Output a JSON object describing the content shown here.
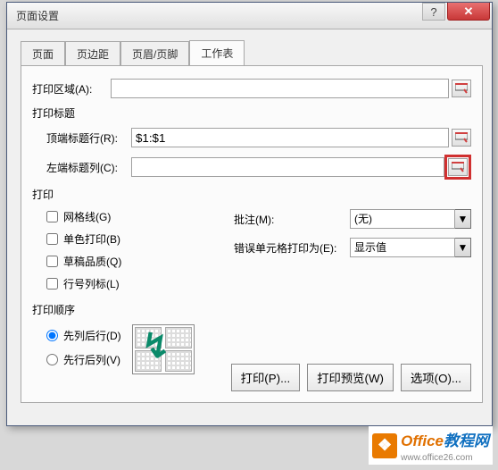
{
  "window": {
    "title": "页面设置"
  },
  "tabs": {
    "page": "页面",
    "margins": "页边距",
    "headerfooter": "页眉/页脚",
    "sheet": "工作表"
  },
  "fields": {
    "print_area_label": "打印区域(A):",
    "print_area_value": "",
    "titles_section": "打印标题",
    "rows_repeat_label": "顶端标题行(R):",
    "rows_repeat_value": "$1:$1",
    "cols_repeat_label": "左端标题列(C):",
    "cols_repeat_value": "",
    "print_section": "打印",
    "gridlines": "网格线(G)",
    "bw": "单色打印(B)",
    "draft": "草稿品质(Q)",
    "rowcolheadings": "行号列标(L)",
    "comments_label": "批注(M):",
    "comments_value": "(无)",
    "errors_label": "错误单元格打印为(E):",
    "errors_value": "显示值",
    "order_section": "打印顺序",
    "down_then_over": "先列后行(D)",
    "over_then_down": "先行后列(V)"
  },
  "buttons": {
    "print": "打印(P)...",
    "preview": "打印预览(W)",
    "options": "选项(O)..."
  },
  "watermark": {
    "brand": "Office",
    "brand_cn": "教程网",
    "url": "www.office26.com"
  }
}
